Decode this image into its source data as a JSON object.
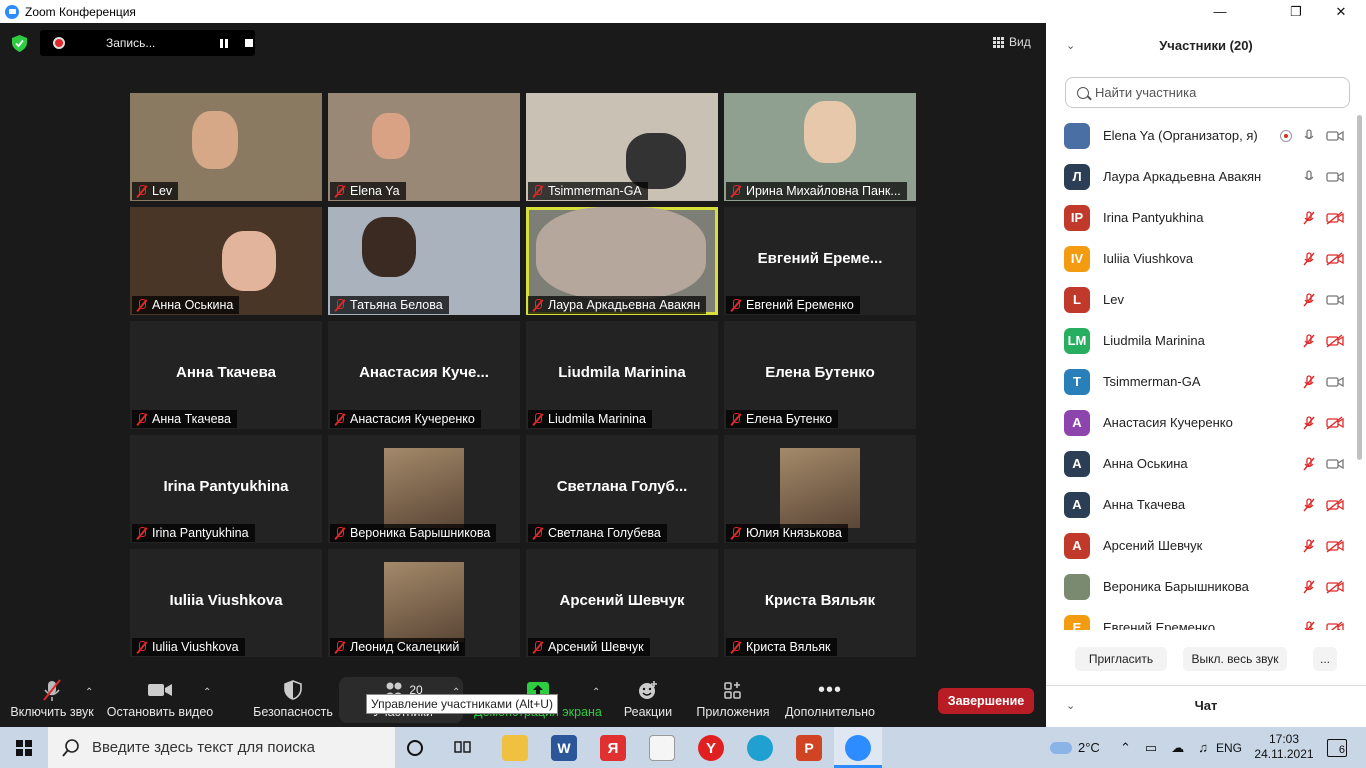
{
  "window": {
    "title": "Zoom Конференция"
  },
  "recording": {
    "label": "Запись..."
  },
  "view_label": "Вид",
  "tiles": [
    {
      "name": "Lev",
      "video": true
    },
    {
      "name": "Elena Ya",
      "video": true
    },
    {
      "name": "Tsimmerman-GA",
      "video": true
    },
    {
      "name": "Ирина Михайловна Панк...",
      "video": true
    },
    {
      "name": "Анна Оськина",
      "video": true
    },
    {
      "name": "Татьяна Белова",
      "video": true
    },
    {
      "name": "Лаура Аркадьевна Авакян",
      "video": true,
      "active": true
    },
    {
      "name": "Евгений Еременко",
      "big": "Евгений  Ереме..."
    },
    {
      "name": "Анна Ткачева",
      "big": "Анна Ткачева"
    },
    {
      "name": "Анастасия Кучеренко",
      "big": "Анастасия  Куче..."
    },
    {
      "name": "Liudmila Marinina",
      "big": "Liudmila Marinina"
    },
    {
      "name": "Елена Бутенко",
      "big": "Елена Бутенко"
    },
    {
      "name": "Irina Pantyukhina",
      "big": "Irina Pantyukhina"
    },
    {
      "name": "Вероника Барышникова",
      "photo": true
    },
    {
      "name": "Светлана Голубева",
      "big": "Светлана  Голуб..."
    },
    {
      "name": "Юлия Князькова",
      "photo": true
    },
    {
      "name": "Iuliia Viushkova",
      "big": "Iuliia Viushkova"
    },
    {
      "name": "Леонид Скалецкий",
      "photo": true
    },
    {
      "name": "Арсений Шевчук",
      "big": "Арсений Шевчук"
    },
    {
      "name": "Криста Вяльяк",
      "big": "Криста Вяльяк"
    }
  ],
  "toolbar": {
    "unmute": "Включить звук",
    "stop_video": "Остановить видео",
    "security": "Безопасность",
    "participants": "Участники",
    "participants_count": "20",
    "share": "Демонстрация экрана",
    "reactions": "Реакции",
    "apps": "Приложения",
    "more": "Дополнительно",
    "end": "Завершение",
    "tooltip": "Управление участниками (Alt+U)"
  },
  "panel": {
    "title": "Участники (20)",
    "search_placeholder": "Найти участника",
    "invite": "Пригласить",
    "mute_all": "Выкл. весь звук",
    "more": "...",
    "chat": "Чат",
    "participants": [
      {
        "initials": "",
        "name": "Elena Ya (Организатор, я)",
        "color": "#4a6fa5",
        "mic": "on",
        "video": "on",
        "rec": true,
        "photo": true
      },
      {
        "initials": "Л",
        "name": "Лаура Аркадьевна Авакян",
        "color": "#2c3e55",
        "mic": "on",
        "video": "on"
      },
      {
        "initials": "IP",
        "name": "Irina Pantyukhina",
        "color": "#c0392b",
        "mic": "off",
        "video": "off"
      },
      {
        "initials": "IV",
        "name": "Iuliia Viushkova",
        "color": "#f39c12",
        "mic": "off",
        "video": "off"
      },
      {
        "initials": "L",
        "name": "Lev",
        "color": "#c0392b",
        "mic": "off",
        "video": "on"
      },
      {
        "initials": "LM",
        "name": "Liudmila Marinina",
        "color": "#27ae60",
        "mic": "off",
        "video": "off"
      },
      {
        "initials": "T",
        "name": "Tsimmerman-GA",
        "color": "#2980b9",
        "mic": "off",
        "video": "on"
      },
      {
        "initials": "А",
        "name": "Анастасия Кучеренко",
        "color": "#8e44ad",
        "mic": "off",
        "video": "off"
      },
      {
        "initials": "А",
        "name": "Анна Оськина",
        "color": "#2c3e55",
        "mic": "off",
        "video": "on"
      },
      {
        "initials": "А",
        "name": "Анна Ткачева",
        "color": "#2c3e55",
        "mic": "off",
        "video": "off"
      },
      {
        "initials": "А",
        "name": "Арсений Шевчук",
        "color": "#c0392b",
        "mic": "off",
        "video": "off"
      },
      {
        "initials": "",
        "name": "Вероника Барышникова",
        "color": "#7a8a70",
        "mic": "off",
        "video": "off",
        "photo": true
      },
      {
        "initials": "Е",
        "name": "Евгений Еременко",
        "color": "#f39c12",
        "mic": "off",
        "video": "off"
      }
    ]
  },
  "taskbar": {
    "search_placeholder": "Введите здесь текст для поиска",
    "weather": "2°C",
    "lang": "ENG",
    "time": "17:03",
    "date": "24.11.2021",
    "notifications": "6"
  }
}
